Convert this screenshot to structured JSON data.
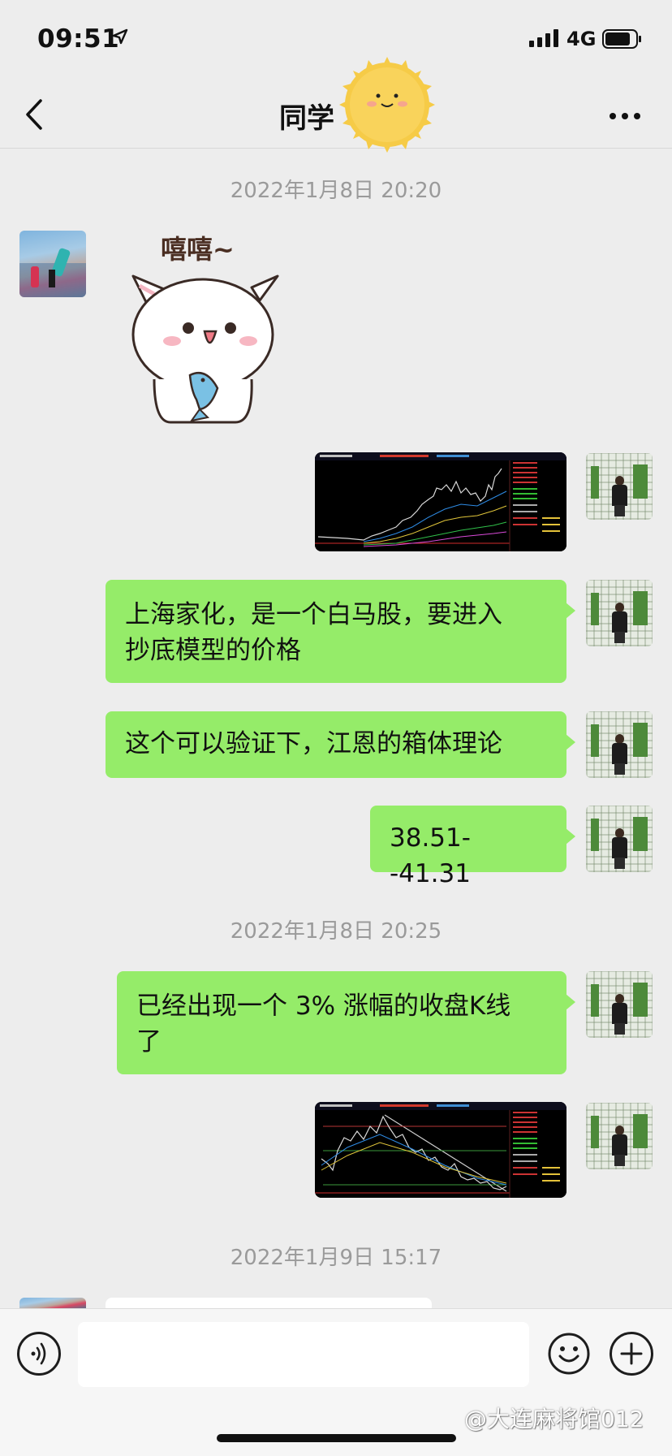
{
  "status_bar": {
    "time": "09:51",
    "network": "4G"
  },
  "nav": {
    "title": "同学",
    "back_icon": "chevron-left-icon",
    "more_icon": "ellipsis-icon"
  },
  "timestamps": [
    "2022年1月8日 20:20",
    "2022年1月8日 20:25",
    "2022年1月9日 15:17"
  ],
  "messages": [
    {
      "from": "friend",
      "type": "sticker",
      "caption": "嘻嘻~"
    },
    {
      "from": "me",
      "type": "image",
      "content": "stock-chart-screenshot"
    },
    {
      "from": "me",
      "type": "text",
      "text_line1": "上海家化，是一个白马股，要进入",
      "text_line2": "抄底模型的价格"
    },
    {
      "from": "me",
      "type": "text",
      "text": "这个可以验证下，江恩的箱体理论"
    },
    {
      "from": "me",
      "type": "text",
      "text": "38.51--41.31"
    },
    {
      "from": "me",
      "type": "text",
      "text_line1": "已经出现一个 3% 涨幅的收盘K线",
      "text_line2": "了"
    },
    {
      "from": "me",
      "type": "image",
      "content": "stock-chart-screenshot"
    }
  ],
  "input_bar": {
    "placeholder": "",
    "voice_icon": "voice-icon",
    "emoji_icon": "emoji-icon",
    "add_icon": "plus-icon"
  },
  "watermark": "@大连麻将馆012",
  "colors": {
    "bubble_green": "#95ec69",
    "background": "#ededed"
  }
}
